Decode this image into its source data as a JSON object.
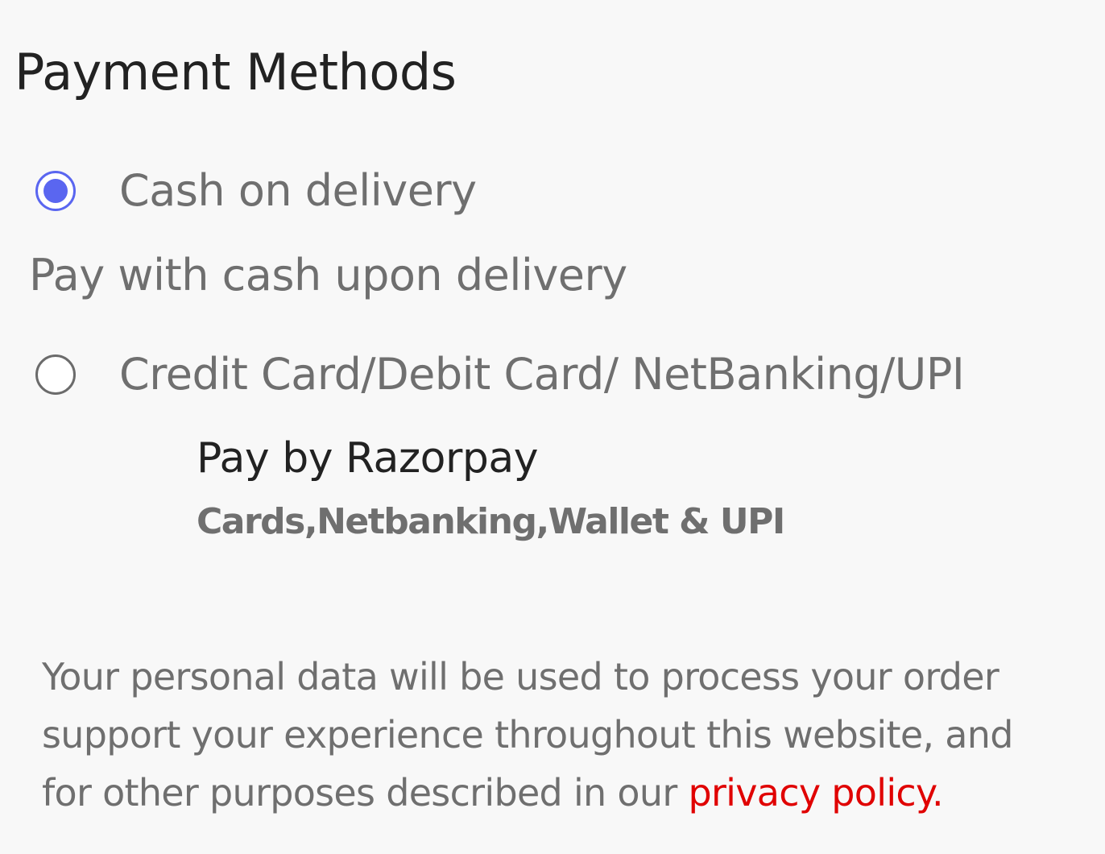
{
  "section": {
    "title": "Payment Methods"
  },
  "options": {
    "cod": {
      "label": "Cash on delivery",
      "description": "Pay with cash upon delivery",
      "selected": true
    },
    "card": {
      "label": "Credit Card/Debit Card/ NetBanking/UPI",
      "selected": false,
      "provider_title": "Pay by Razorpay",
      "provider_subtitle": "Cards,Netbanking,Wallet & UPI"
    }
  },
  "privacy": {
    "line1": "Your personal data will be used to process your order",
    "line2": "support your experience throughout this website, and",
    "line3_prefix": "for other purposes described in our ",
    "link_text": "privacy policy."
  },
  "colors": {
    "accent": "#5a66f0",
    "link": "#e00000",
    "heading": "#222222",
    "text": "#6f6f6f",
    "background": "#f8f8f8"
  }
}
